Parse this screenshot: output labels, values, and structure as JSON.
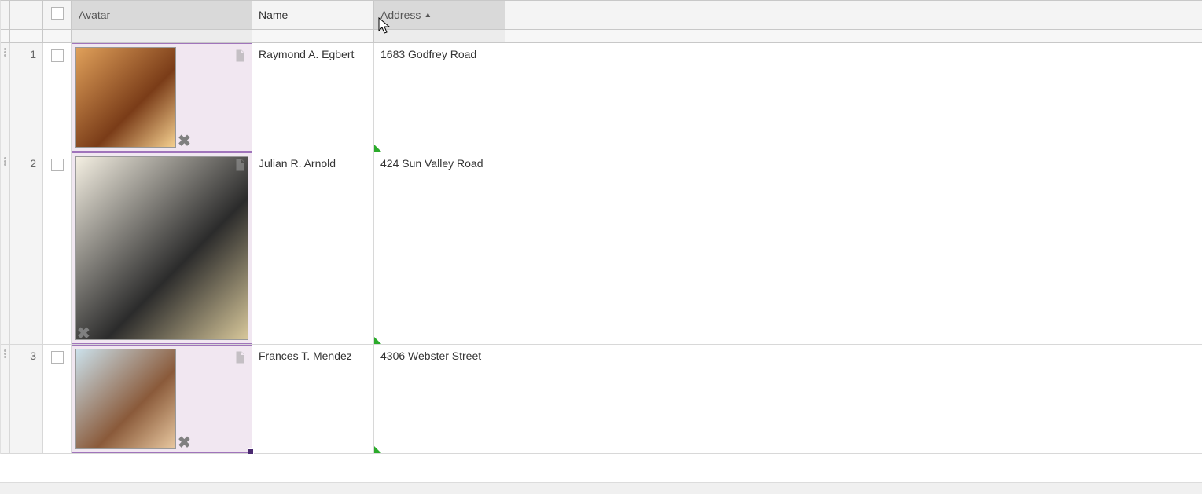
{
  "columns": {
    "avatar": "Avatar",
    "name": "Name",
    "address": "Address",
    "sort_indicator": "▲"
  },
  "rows": [
    {
      "num": "1",
      "name": "Raymond A. Egbert",
      "address": "1683 Godfrey Road",
      "avatar_w": 126,
      "avatar_h": 126,
      "avatar_colors": [
        "#e0a05a",
        "#7a3c18",
        "#f5d090"
      ],
      "remove_right": 4,
      "remove_bottom": 2
    },
    {
      "num": "2",
      "name": "Julian R. Arnold",
      "address": "424 Sun Valley Road",
      "avatar_w": 218,
      "avatar_h": 232,
      "avatar_colors": [
        "#f4efe2",
        "#2b2b2b",
        "#d7c79a"
      ],
      "remove_right": null,
      "remove_bottom": 2
    },
    {
      "num": "3",
      "name": "Frances T. Mendez",
      "address": "4306 Webster Street",
      "avatar_w": 126,
      "avatar_h": 126,
      "avatar_colors": [
        "#cbe0ea",
        "#8a5a3a",
        "#e8c8a0"
      ],
      "remove_right": 4,
      "remove_bottom": 2
    }
  ]
}
